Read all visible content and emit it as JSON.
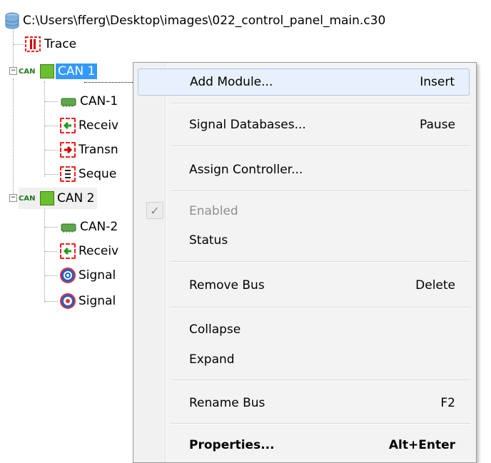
{
  "tree": {
    "root_path": "C:\\Users\\fferg\\Desktop\\images\\022_control_panel_main.c30",
    "trace_label": "Trace",
    "can_tag": "CAN",
    "can1": {
      "label": "CAN 1",
      "children": [
        "CAN-1",
        "Receiv",
        "Transn",
        "Seque"
      ]
    },
    "can2": {
      "label": "CAN 2",
      "children": [
        "CAN-2",
        "Receiv",
        "Signal",
        "Signal"
      ]
    }
  },
  "menu": {
    "items": [
      {
        "label": "Add Module...",
        "shortcut": "Insert"
      },
      {
        "label": "Signal Databases...",
        "shortcut": "Pause"
      },
      {
        "label": "Assign Controller...",
        "shortcut": ""
      },
      {
        "label": "Enabled",
        "shortcut": ""
      },
      {
        "label": "Status",
        "shortcut": ""
      },
      {
        "label": "Remove Bus",
        "shortcut": "Delete"
      },
      {
        "label": "Collapse",
        "shortcut": ""
      },
      {
        "label": "Expand",
        "shortcut": ""
      },
      {
        "label": "Rename Bus",
        "shortcut": "F2"
      },
      {
        "label": "Properties...",
        "shortcut": "Alt+Enter"
      }
    ],
    "checkmark": "✓"
  },
  "colors": {
    "selection": "#3399ff",
    "menu_highlight": "#e8f1fb",
    "red_icon": "#ff1a1a",
    "green_icon": "#6abf2f",
    "blue_icon": "#1b5fd1"
  },
  "icons": [
    "database-icon",
    "trace-icon",
    "can-bus-icon",
    "chip-icon",
    "receive-icon",
    "transmit-icon",
    "sequence-icon",
    "signal-icon",
    "checkmark-icon"
  ]
}
